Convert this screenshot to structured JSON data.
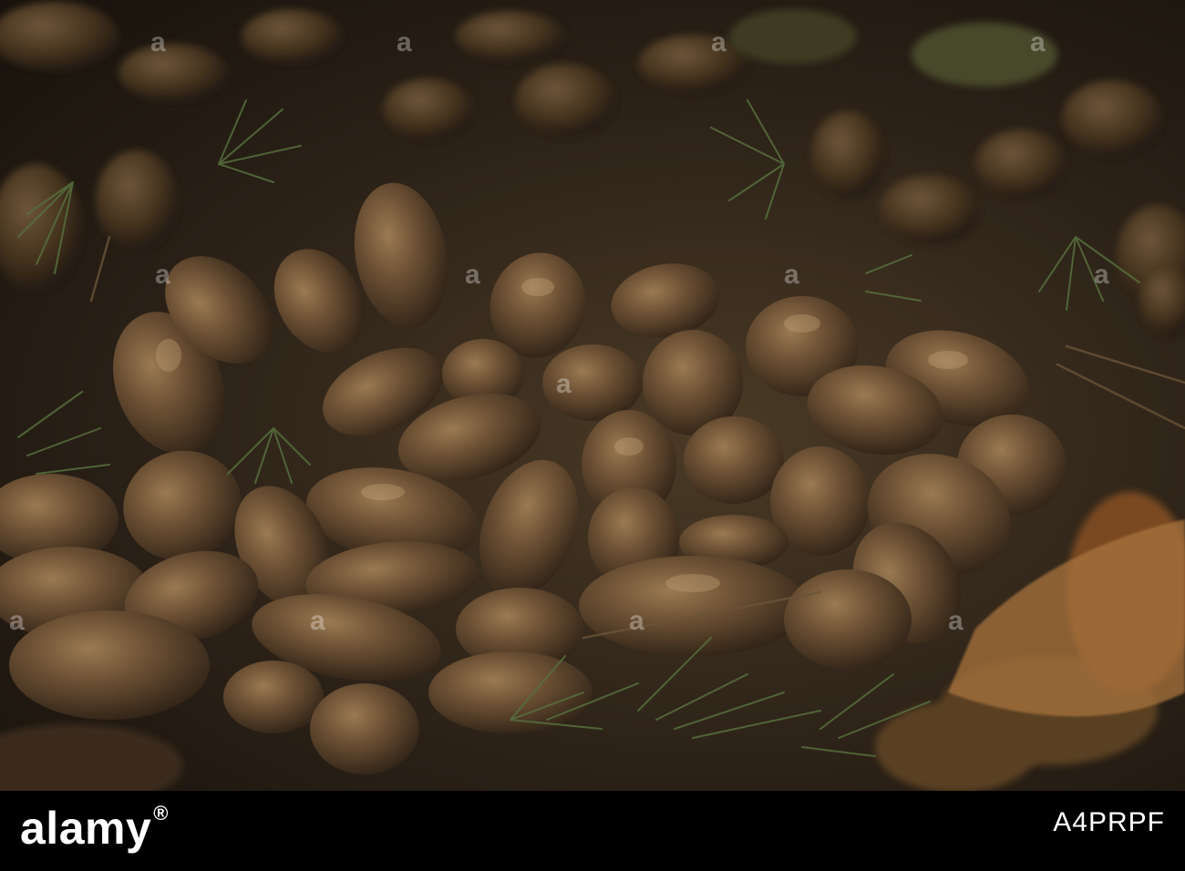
{
  "footer": {
    "brand": "alamy",
    "registered_mark": "®",
    "image_id": "A4PRPF"
  },
  "watermark": {
    "text": "a",
    "icon": "alamy-watermark-icon"
  },
  "colors": {
    "pellet_base": "#5a4128",
    "pellet_highlight": "#8a6a44",
    "needle_green": "#4f6b3a",
    "footer_background": "#000000"
  }
}
